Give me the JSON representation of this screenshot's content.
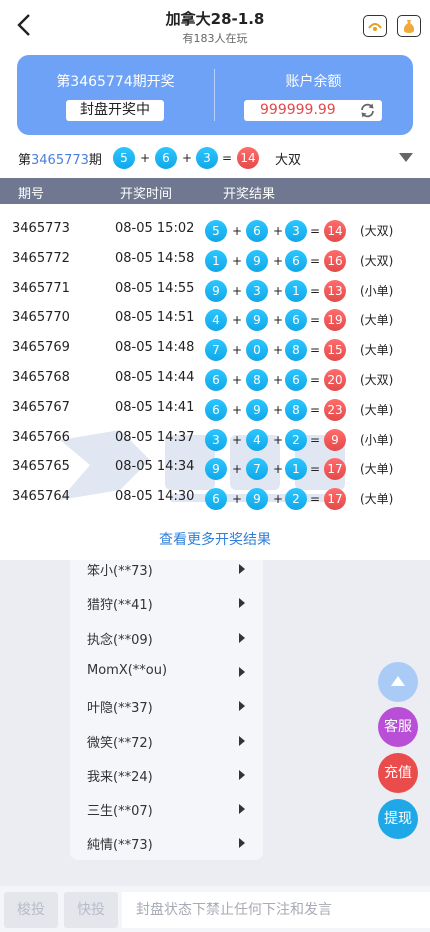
{
  "header": {
    "title": "加拿大28-1.8",
    "subtitle": "有183人在玩"
  },
  "card": {
    "issue_label": "第3465774期开奖",
    "status": "封盘开奖中",
    "balance_label": "账户余额",
    "balance": "999999.99"
  },
  "current": {
    "prefix": "第",
    "issue": "3465773",
    "suffix": "期",
    "balls": [
      "5",
      "6",
      "3"
    ],
    "sum": "14",
    "tag": "大双"
  },
  "table": {
    "headers": [
      "期号",
      "开奖时间",
      "开奖结果"
    ],
    "rows": [
      {
        "issue": "3465773",
        "time": "08-05 15:02",
        "balls": [
          "5",
          "6",
          "3"
        ],
        "sum": "14",
        "tag": "(大双)"
      },
      {
        "issue": "3465772",
        "time": "08-05 14:58",
        "balls": [
          "1",
          "9",
          "6"
        ],
        "sum": "16",
        "tag": "(大双)"
      },
      {
        "issue": "3465771",
        "time": "08-05 14:55",
        "balls": [
          "9",
          "3",
          "1"
        ],
        "sum": "13",
        "tag": "(小单)"
      },
      {
        "issue": "3465770",
        "time": "08-05 14:51",
        "balls": [
          "4",
          "9",
          "6"
        ],
        "sum": "19",
        "tag": "(大单)"
      },
      {
        "issue": "3465769",
        "time": "08-05 14:48",
        "balls": [
          "7",
          "0",
          "8"
        ],
        "sum": "15",
        "tag": "(大单)"
      },
      {
        "issue": "3465768",
        "time": "08-05 14:44",
        "balls": [
          "6",
          "8",
          "6"
        ],
        "sum": "20",
        "tag": "(大双)"
      },
      {
        "issue": "3465767",
        "time": "08-05 14:41",
        "balls": [
          "6",
          "9",
          "8"
        ],
        "sum": "23",
        "tag": "(大单)"
      },
      {
        "issue": "3465766",
        "time": "08-05 14:37",
        "balls": [
          "3",
          "4",
          "2"
        ],
        "sum": "9",
        "tag": "(小单)"
      },
      {
        "issue": "3465765",
        "time": "08-05 14:34",
        "balls": [
          "9",
          "7",
          "1"
        ],
        "sum": "17",
        "tag": "(大单)"
      },
      {
        "issue": "3465764",
        "time": "08-05 14:30",
        "balls": [
          "6",
          "9",
          "2"
        ],
        "sum": "17",
        "tag": "(大单)"
      }
    ],
    "more": "查看更多开奖结果"
  },
  "menu": {
    "items": [
      "笨小(**73)",
      "猎狩(**41)",
      "执念(**09)",
      "MomX(**ou)",
      "叶隐(**37)",
      "微笑(**72)",
      "我来(**24)",
      "三生(**07)",
      "純情(**73)"
    ]
  },
  "fabs": {
    "service": "客服",
    "recharge": "充值",
    "withdraw": "提现"
  },
  "bottom": {
    "btn1": "梭投",
    "btn2": "快投",
    "placeholder": "封盘状态下禁止任何下注和发言"
  },
  "colors": {
    "card_blue": "#6da2f7",
    "ball_blue": "#1ab4f2",
    "ball_red": "#e84f4f",
    "link_blue": "#2f7fd8"
  }
}
